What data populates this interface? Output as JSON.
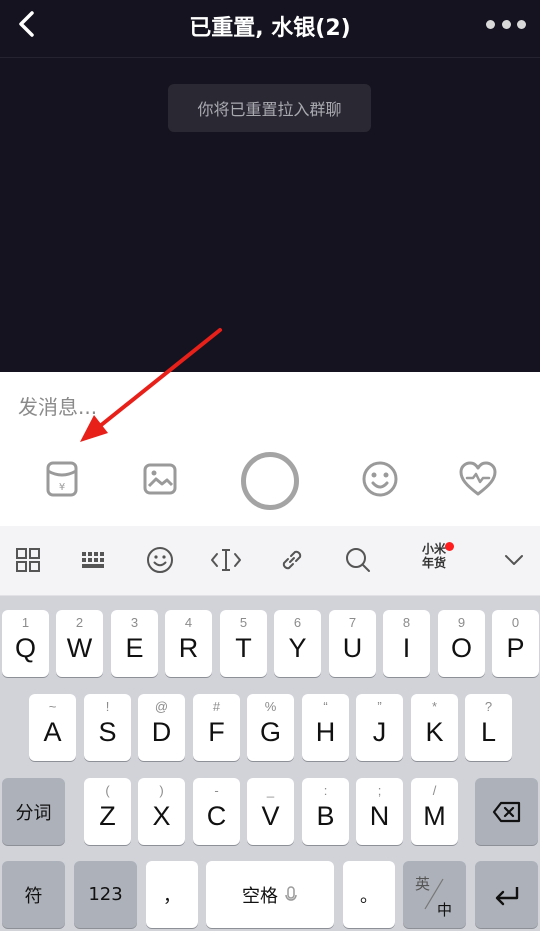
{
  "header": {
    "title": "已重置, 水银(2)",
    "back_icon": "back-chevron-icon",
    "more_icon": "more-dots-icon"
  },
  "chat": {
    "system_message": "你将已重置拉入群聊"
  },
  "composer": {
    "placeholder": "发消息...",
    "tools": [
      "red-packet-icon",
      "image-icon",
      "record-button",
      "emoji-icon",
      "heart-icon"
    ]
  },
  "keyboard_toolbar": {
    "items": [
      "grid-icon",
      "keyboard-icon",
      "smiley-icon",
      "cursor-icon",
      "link-icon",
      "search-icon"
    ],
    "promo_line1": "小米",
    "promo_line2": "年货",
    "collapse_icon": "chevron-down-icon"
  },
  "keyboard": {
    "row1": [
      {
        "main": "Q",
        "sub": "1"
      },
      {
        "main": "W",
        "sub": "2"
      },
      {
        "main": "E",
        "sub": "3"
      },
      {
        "main": "R",
        "sub": "4"
      },
      {
        "main": "T",
        "sub": "5"
      },
      {
        "main": "Y",
        "sub": "6"
      },
      {
        "main": "U",
        "sub": "7"
      },
      {
        "main": "I",
        "sub": "8"
      },
      {
        "main": "O",
        "sub": "9"
      },
      {
        "main": "P",
        "sub": "0"
      }
    ],
    "row2": [
      {
        "main": "A",
        "sub": "~"
      },
      {
        "main": "S",
        "sub": "!"
      },
      {
        "main": "D",
        "sub": "@"
      },
      {
        "main": "F",
        "sub": "#"
      },
      {
        "main": "G",
        "sub": "%"
      },
      {
        "main": "H",
        "sub": "“"
      },
      {
        "main": "J",
        "sub": "”"
      },
      {
        "main": "K",
        "sub": "*"
      },
      {
        "main": "L",
        "sub": "?"
      }
    ],
    "row3": [
      {
        "main": "Z",
        "sub": "("
      },
      {
        "main": "X",
        "sub": ")"
      },
      {
        "main": "C",
        "sub": "-"
      },
      {
        "main": "V",
        "sub": "_"
      },
      {
        "main": "B",
        "sub": ":"
      },
      {
        "main": "N",
        "sub": ";"
      },
      {
        "main": "M",
        "sub": "/"
      }
    ],
    "segment_label": "分词",
    "symbol_label": "符",
    "number_label": "123",
    "comma_label": "，",
    "space_label": "空格",
    "period_label": "。",
    "lang_top": "英",
    "lang_bottom": "中",
    "backspace_icon": "backspace-icon",
    "enter_icon": "enter-icon"
  },
  "annotation": {
    "color": "#e8201a"
  }
}
